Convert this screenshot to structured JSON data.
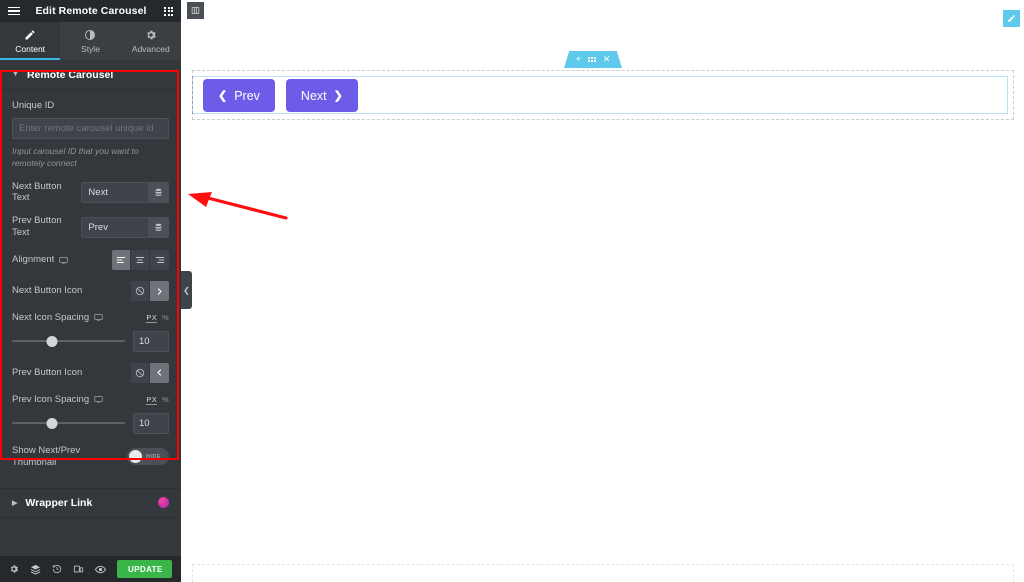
{
  "panel": {
    "header": {
      "menu_icon": "hamburger-icon",
      "title": "Edit Remote Carousel",
      "apps_icon": "grid-apps-icon"
    },
    "tabs": [
      {
        "label": "Content",
        "icon": "pencil-icon",
        "active": true
      },
      {
        "label": "Style",
        "icon": "half-circle-icon",
        "active": false
      },
      {
        "label": "Advanced",
        "icon": "gear-icon",
        "active": false
      }
    ],
    "sections": [
      {
        "title": "Remote Carousel",
        "expanded": true,
        "caret": "caret-down-icon"
      },
      {
        "title": "Wrapper Link",
        "expanded": false,
        "caret": "caret-right-icon",
        "badge": "pro-badge"
      }
    ],
    "controls": {
      "unique_id": {
        "label": "Unique ID",
        "value": "",
        "placeholder": "Enter remote carousel unique id",
        "help": "Input carousel ID that you want to remotely connect"
      },
      "next_button_text": {
        "label": "Next Button Text",
        "value": "Next",
        "dynamic_icon": "database-icon"
      },
      "prev_button_text": {
        "label": "Prev Button Text",
        "value": "Prev",
        "dynamic_icon": "database-icon"
      },
      "alignment": {
        "label": "Alignment",
        "device_icon": "monitor-icon",
        "options": [
          {
            "name": "align-left",
            "selected": true
          },
          {
            "name": "align-center",
            "selected": false
          },
          {
            "name": "align-right",
            "selected": false
          }
        ]
      },
      "next_button_icon": {
        "label": "Next Button Icon",
        "options": [
          {
            "name": "none-icon",
            "selected": false
          },
          {
            "name": "chevron-right-icon",
            "selected": true
          }
        ]
      },
      "next_icon_spacing": {
        "label": "Next Icon Spacing",
        "device_icon": "monitor-icon",
        "units": [
          {
            "label": "PX",
            "active": true
          },
          {
            "label": "%",
            "active": false
          }
        ],
        "value": "10"
      },
      "prev_button_icon": {
        "label": "Prev Button Icon",
        "options": [
          {
            "name": "none-icon",
            "selected": false
          },
          {
            "name": "chevron-left-icon",
            "selected": true
          }
        ]
      },
      "prev_icon_spacing": {
        "label": "Prev Icon Spacing",
        "device_icon": "monitor-icon",
        "units": [
          {
            "label": "PX",
            "active": true
          },
          {
            "label": "%",
            "active": false
          }
        ],
        "value": "10"
      },
      "show_thumbnail": {
        "label": "Show Next/Prev Thumbnail",
        "state_label": "HIDE",
        "on": false
      }
    },
    "collapse_tab": {
      "icon": "chevron-left-icon"
    },
    "footer": {
      "icons": [
        "settings-gear-icon",
        "navigator-layers-icon",
        "history-icon",
        "responsive-mode-icon",
        "preview-eye-icon"
      ],
      "update_label": "UPDATE",
      "update_arrow": "caret-up-icon"
    }
  },
  "canvas": {
    "section_toolbar": {
      "add_icon": "plus-icon",
      "drag_icon": "drag-dots-icon",
      "close_icon": "close-x-icon"
    },
    "widget_handle_icon": "columns-icon",
    "edit_handle_icon": "pencil-edit-icon",
    "buttons": [
      {
        "label": "Prev",
        "icon": "chevron-left-icon",
        "icon_position": "before"
      },
      {
        "label": "Next",
        "icon": "chevron-right-icon",
        "icon_position": "after"
      }
    ]
  },
  "annotation": {
    "arrow": "red-arrow-pointing-left"
  },
  "colors": {
    "panel_bg": "#34383c",
    "panel_header_bg": "#26292c",
    "accent_blue": "#39b4e6",
    "update_green": "#39b54a",
    "button_purple": "#6c5ce7",
    "highlight_red": "#ff0000",
    "elementor_cyan": "#5fc9ec"
  }
}
